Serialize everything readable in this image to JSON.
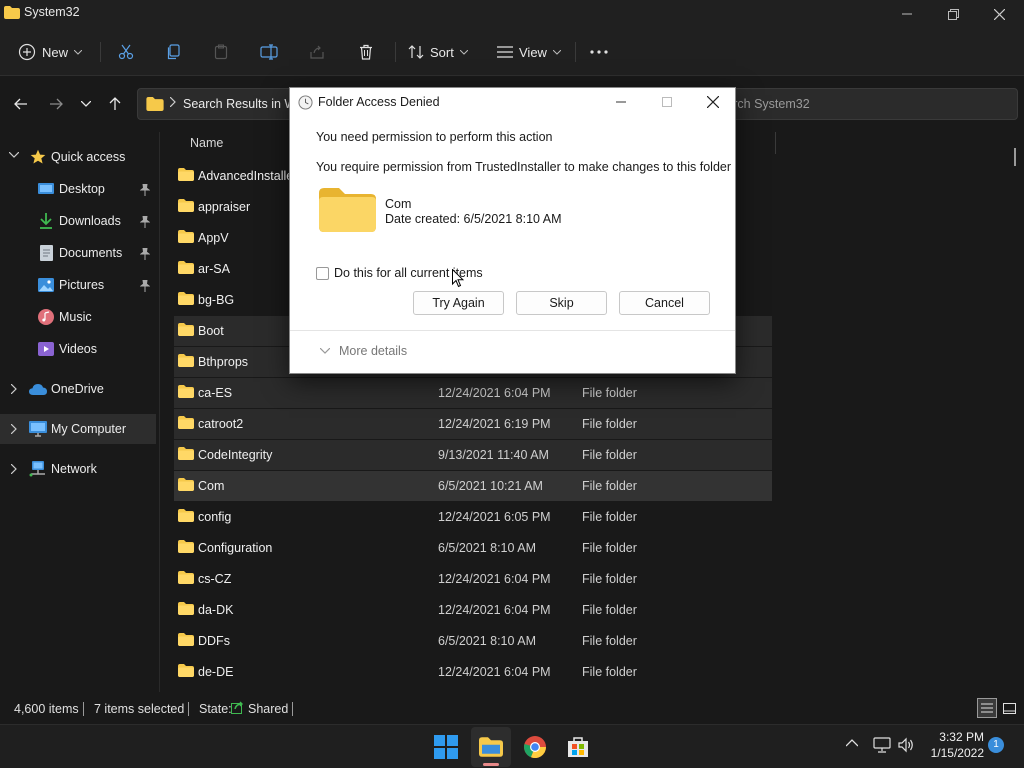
{
  "window": {
    "title": "System32"
  },
  "toolbar": {
    "new_label": "New",
    "sort_label": "Sort",
    "view_label": "View"
  },
  "address": {
    "crumb": "Search Results in Wi",
    "search_placeholder": "Search System32"
  },
  "sidebar": {
    "quick_access": "Quick access",
    "items": [
      {
        "label": "Desktop"
      },
      {
        "label": "Downloads"
      },
      {
        "label": "Documents"
      },
      {
        "label": "Pictures"
      },
      {
        "label": "Music"
      },
      {
        "label": "Videos"
      }
    ],
    "onedrive": "OneDrive",
    "my_computer": "My Computer",
    "network": "Network"
  },
  "list": {
    "header_name": "Name",
    "rows": [
      {
        "name": "AdvancedInstallers",
        "date": "",
        "type": ""
      },
      {
        "name": "appraiser",
        "date": "",
        "type": ""
      },
      {
        "name": "AppV",
        "date": "",
        "type": ""
      },
      {
        "name": "ar-SA",
        "date": "",
        "type": ""
      },
      {
        "name": "bg-BG",
        "date": "",
        "type": ""
      },
      {
        "name": "Boot",
        "date": "",
        "type": ""
      },
      {
        "name": "Bthprops",
        "date": "",
        "type": ""
      },
      {
        "name": "ca-ES",
        "date": "12/24/2021 6:04 PM",
        "type": "File folder"
      },
      {
        "name": "catroot2",
        "date": "12/24/2021 6:19 PM",
        "type": "File folder"
      },
      {
        "name": "CodeIntegrity",
        "date": "9/13/2021 11:40 AM",
        "type": "File folder"
      },
      {
        "name": "Com",
        "date": "6/5/2021 10:21 AM",
        "type": "File folder"
      },
      {
        "name": "config",
        "date": "12/24/2021 6:05 PM",
        "type": "File folder"
      },
      {
        "name": "Configuration",
        "date": "6/5/2021 8:10 AM",
        "type": "File folder"
      },
      {
        "name": "cs-CZ",
        "date": "12/24/2021 6:04 PM",
        "type": "File folder"
      },
      {
        "name": "da-DK",
        "date": "12/24/2021 6:04 PM",
        "type": "File folder"
      },
      {
        "name": "DDFs",
        "date": "6/5/2021 8:10 AM",
        "type": "File folder"
      },
      {
        "name": "de-DE",
        "date": "12/24/2021 6:04 PM",
        "type": "File folder"
      }
    ]
  },
  "status": {
    "count": "4,600 items",
    "selected": "7 items selected",
    "state_label": "State:",
    "state_value": "Shared"
  },
  "dialog": {
    "title": "Folder Access Denied",
    "line1": "You need permission to perform this action",
    "line2": "You require permission from TrustedInstaller to make changes to this folder",
    "item_name": "Com",
    "item_date": "Date created: 6/5/2021 8:10 AM",
    "checkbox_label": "Do this for all current items",
    "try_again": "Try Again",
    "skip": "Skip",
    "cancel": "Cancel",
    "more_details": "More details"
  },
  "clock": {
    "time": "3:32 PM",
    "date": "1/15/2022"
  },
  "notifications": {
    "count": "1"
  },
  "colors": {
    "accent": "#0078d4",
    "folder": "#f6c94a"
  }
}
